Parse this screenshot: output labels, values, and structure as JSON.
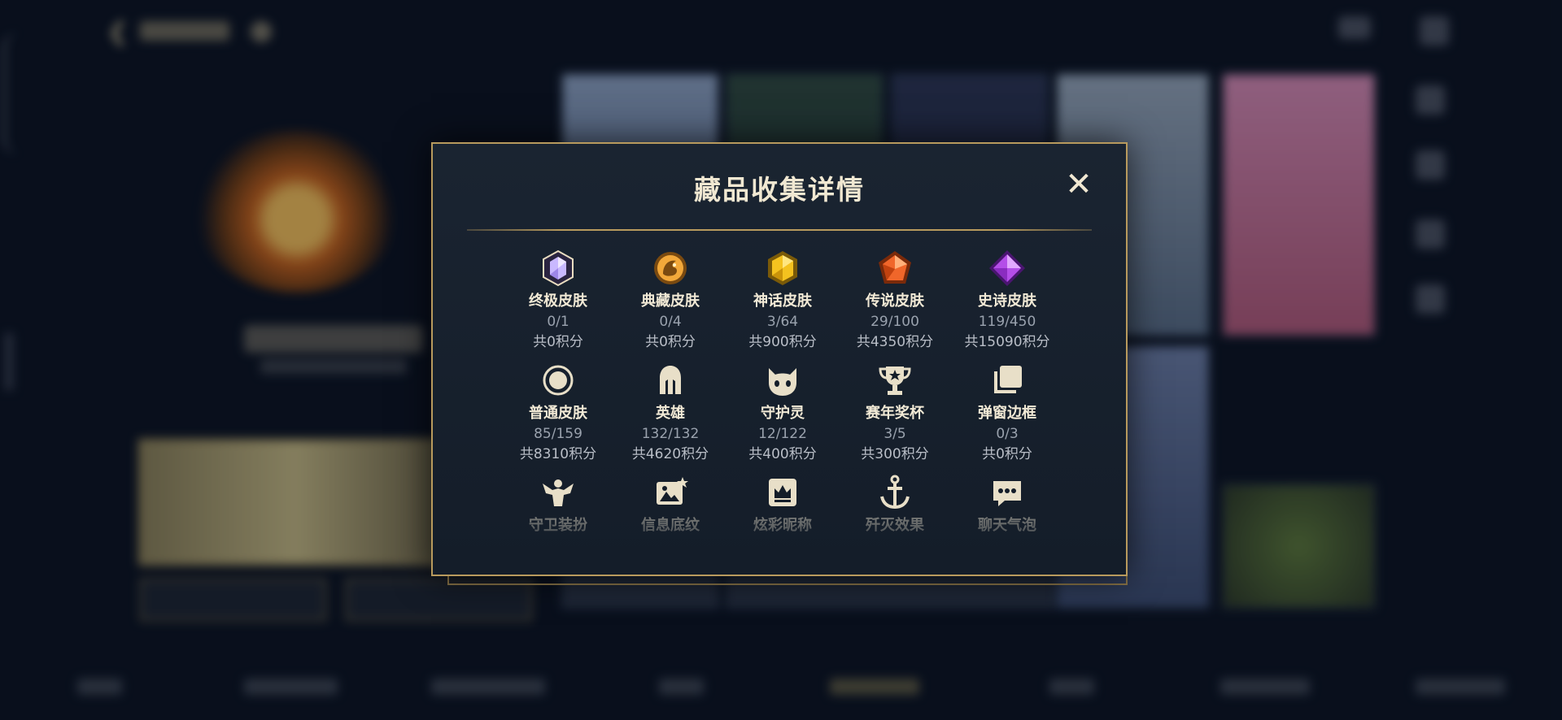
{
  "modal": {
    "title": "藏品收集详情",
    "close_symbol": "✕"
  },
  "items": [
    {
      "icon": "ultimate-skin-gem-icon",
      "label": "终极皮肤",
      "count": "0/1",
      "points": "共0积分",
      "color": "#b9a8f5"
    },
    {
      "icon": "collector-skin-dragon-icon",
      "label": "典藏皮肤",
      "count": "0/4",
      "points": "共0积分",
      "color": "#f0a93a"
    },
    {
      "icon": "mythic-skin-gem-icon",
      "label": "神话皮肤",
      "count": "3/64",
      "points": "共900积分",
      "color": "#f4c21f"
    },
    {
      "icon": "legendary-skin-gem-icon",
      "label": "传说皮肤",
      "count": "29/100",
      "points": "共4350积分",
      "color": "#f0662a"
    },
    {
      "icon": "epic-skin-gem-icon",
      "label": "史诗皮肤",
      "count": "119/450",
      "points": "共15090积分",
      "color": "#b44ee8"
    },
    {
      "icon": "common-skin-circle-icon",
      "label": "普通皮肤",
      "count": "85/159",
      "points": "共8310积分",
      "color": "#e8dfc8"
    },
    {
      "icon": "hero-helmet-icon",
      "label": "英雄",
      "count": "132/132",
      "points": "共4620积分",
      "color": "#e8dfc8"
    },
    {
      "icon": "guardian-spirit-icon",
      "label": "守护灵",
      "count": "12/122",
      "points": "共400积分",
      "color": "#e8dfc8"
    },
    {
      "icon": "season-trophy-icon",
      "label": "赛年奖杯",
      "count": "3/5",
      "points": "共300积分",
      "color": "#e8dfc8"
    },
    {
      "icon": "popup-frame-icon",
      "label": "弹窗边框",
      "count": "0/3",
      "points": "共0积分",
      "color": "#e8dfc8"
    },
    {
      "icon": "guard-outfit-icon",
      "label": "守卫装扮",
      "color": "#e8dfc8"
    },
    {
      "icon": "info-background-icon",
      "label": "信息底纹",
      "color": "#e8dfc8"
    },
    {
      "icon": "colorful-nickname-icon",
      "label": "炫彩昵称",
      "color": "#e8dfc8"
    },
    {
      "icon": "annihilation-effect-icon",
      "label": "歼灭效果",
      "color": "#e8dfc8"
    },
    {
      "icon": "chat-bubble-icon",
      "label": "聊天气泡",
      "color": "#e8dfc8"
    }
  ],
  "colors": {
    "accent_gold": "#b89a5d",
    "modal_bg": "#1a2431",
    "page_bg": "#0b1220"
  }
}
